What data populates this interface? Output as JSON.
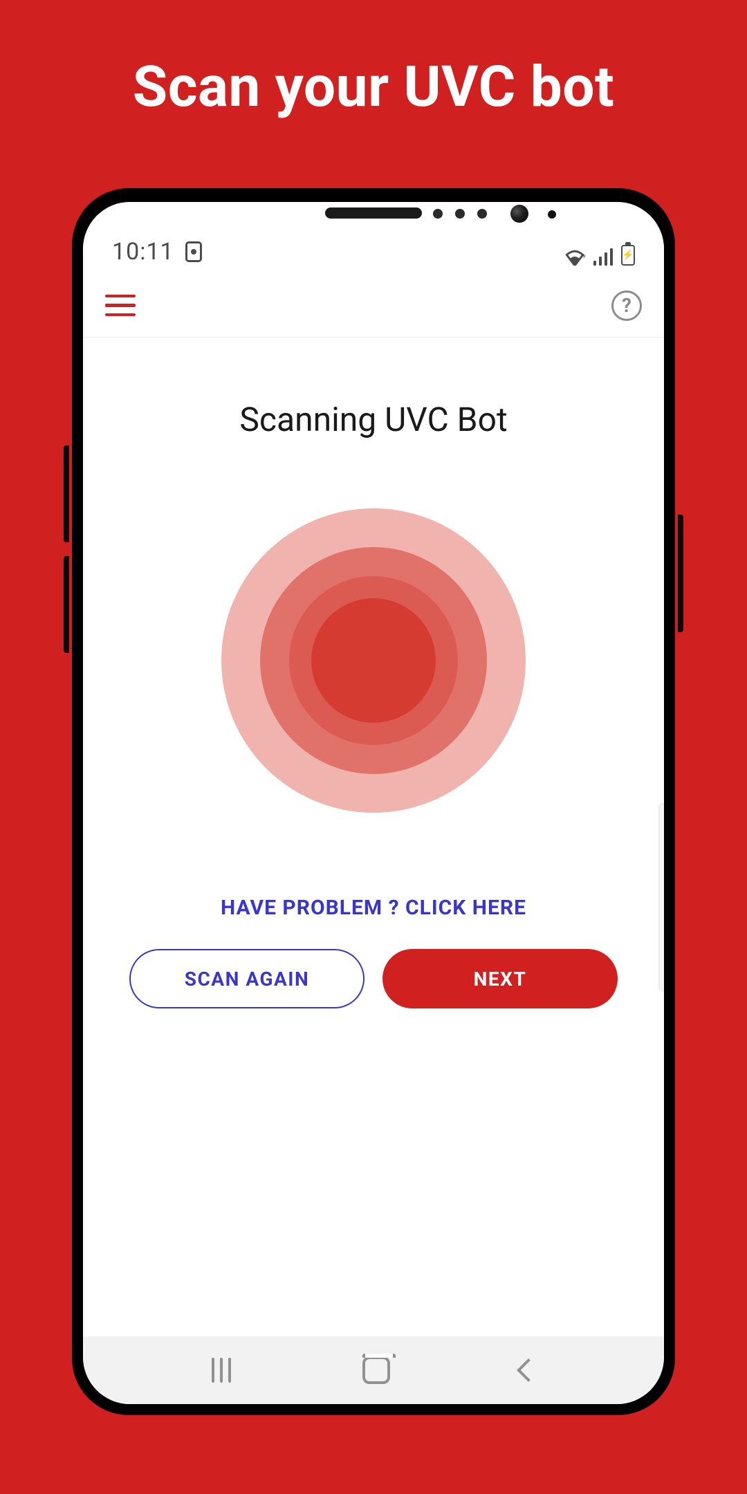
{
  "page": {
    "title": "Scan your UVC bot"
  },
  "statusbar": {
    "time": "10:11"
  },
  "header": {
    "help_label": "?"
  },
  "screen": {
    "title": "Scanning UVC Bot",
    "problem_link": "HAVE PROBLEM ? CLICK HERE"
  },
  "buttons": {
    "scan_again": "SCAN AGAIN",
    "next": "NEXT"
  },
  "colors": {
    "brand": "#D02020",
    "link": "#3a36c7"
  }
}
